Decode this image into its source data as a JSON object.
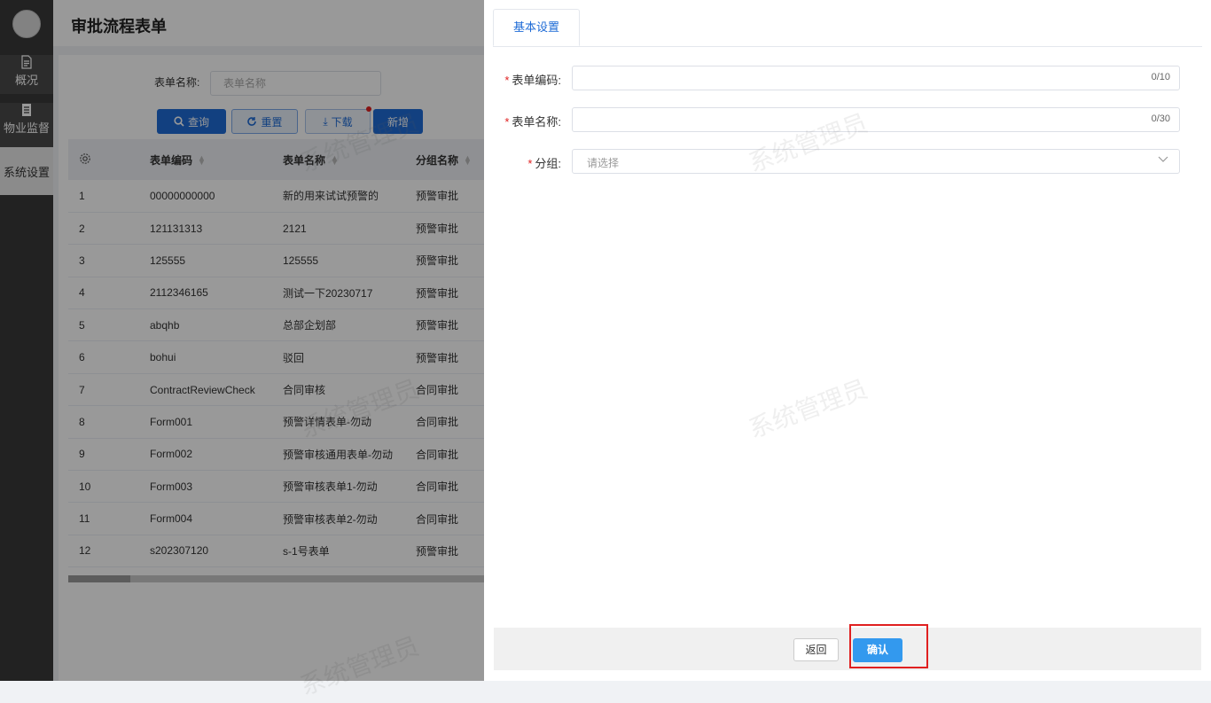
{
  "sidebar": {
    "items": [
      {
        "label": "概况"
      },
      {
        "label": "物业监督"
      },
      {
        "label": "系统设置"
      }
    ]
  },
  "header": {
    "title": "审批流程表单"
  },
  "search": {
    "label": "表单名称:",
    "placeholder": "表单名称"
  },
  "toolbar": {
    "query_label": "查询",
    "reset_label": "重置",
    "download_label": "下载",
    "new_label": "新增"
  },
  "table": {
    "columns": [
      "表单编码",
      "表单名称",
      "分组名称"
    ],
    "rows": [
      {
        "index": "1",
        "code": "00000000000",
        "name": "新的用来试试预警的",
        "group": "预警审批"
      },
      {
        "index": "2",
        "code": "121131313",
        "name": "2121",
        "group": "预警审批"
      },
      {
        "index": "3",
        "code": "125555",
        "name": "125555",
        "group": "预警审批"
      },
      {
        "index": "4",
        "code": "2112346165",
        "name": "测试一下20230717",
        "group": "预警审批"
      },
      {
        "index": "5",
        "code": "abqhb",
        "name": "总部企划部",
        "group": "预警审批"
      },
      {
        "index": "6",
        "code": "bohui",
        "name": "驳回",
        "group": "预警审批"
      },
      {
        "index": "7",
        "code": "ContractReviewCheck",
        "name": "合同审核",
        "group": "合同审批"
      },
      {
        "index": "8",
        "code": "Form001",
        "name": "预警详情表单-勿动",
        "group": "合同审批"
      },
      {
        "index": "9",
        "code": "Form002",
        "name": "预警审核通用表单-勿动",
        "group": "合同审批"
      },
      {
        "index": "10",
        "code": "Form003",
        "name": "预警审核表单1-勿动",
        "group": "合同审批"
      },
      {
        "index": "11",
        "code": "Form004",
        "name": "预警审核表单2-勿动",
        "group": "合同审批"
      },
      {
        "index": "12",
        "code": "s202307120",
        "name": "s-1号表单",
        "group": "预警审批"
      }
    ]
  },
  "drawer": {
    "tab_label": "基本设置",
    "fields": {
      "code": {
        "label": "表单编码:",
        "value": "",
        "counter": "0/10"
      },
      "name": {
        "label": "表单名称:",
        "value": "",
        "counter": "0/30"
      },
      "group": {
        "label": "分组:",
        "placeholder": "请选择"
      }
    },
    "back_label": "返回",
    "confirm_label": "确认"
  },
  "watermark": "系统管理员",
  "colors": {
    "primary": "#1e6bd6",
    "confirm": "#3399ee",
    "highlight": "#e02020",
    "sidebar": "#3a3a3a"
  }
}
